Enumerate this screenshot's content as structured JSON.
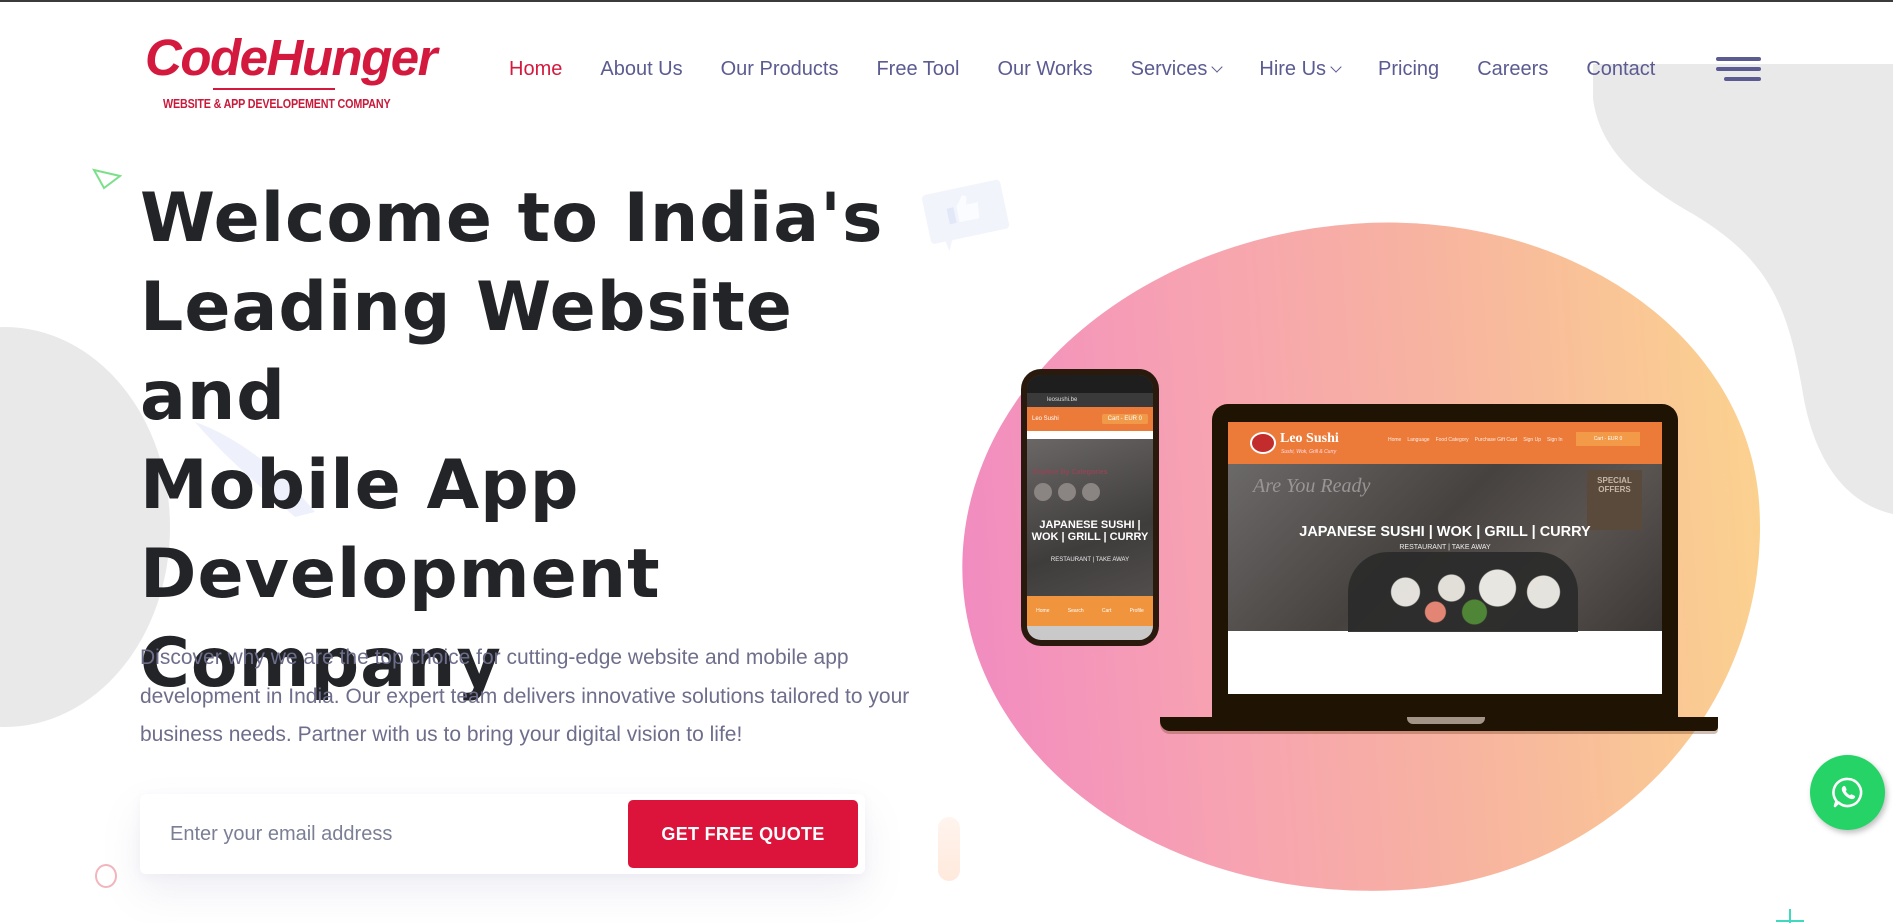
{
  "brand": {
    "name": "CodeHunger",
    "tagline": "WEBSITE & APP DEVELOPEMENT COMPANY",
    "primary_color": "#dc143c",
    "nav_color": "#5b5b92"
  },
  "nav": {
    "items": [
      {
        "label": "Home",
        "active": true,
        "dropdown": false
      },
      {
        "label": "About Us",
        "active": false,
        "dropdown": false
      },
      {
        "label": "Our Products",
        "active": false,
        "dropdown": false
      },
      {
        "label": "Free Tool",
        "active": false,
        "dropdown": false
      },
      {
        "label": "Our Works",
        "active": false,
        "dropdown": false
      },
      {
        "label": "Services",
        "active": false,
        "dropdown": true
      },
      {
        "label": "Hire Us",
        "active": false,
        "dropdown": true
      },
      {
        "label": "Pricing",
        "active": false,
        "dropdown": false
      },
      {
        "label": "Careers",
        "active": false,
        "dropdown": false
      },
      {
        "label": "Contact",
        "active": false,
        "dropdown": false
      }
    ],
    "menu_icon": "hamburger-icon"
  },
  "hero": {
    "title_lines": [
      "Welcome to India's",
      "Leading Website and",
      "Mobile App",
      "Development",
      "Company"
    ],
    "description": "Discover why we are the top choice for cutting-edge website and mobile app development in India. Our expert team delivers innovative solutions tailored to your business needs. Partner with us to bring your digital vision to life!",
    "email_placeholder": "Enter your email address",
    "email_value": "",
    "cta_label": "GET FREE QUOTE"
  },
  "showcase": {
    "laptop": {
      "brand": "Leo Sushi",
      "tagline": "Sushi, Wok, Grill & Curry",
      "menu": [
        "Home",
        "Language",
        "Food Category",
        "Purchase Gift Card",
        "Sign Up",
        "Sign In"
      ],
      "cart": "Cart - EUR 0",
      "promo_left": "Are You Ready",
      "promo_right": "SPECIAL OFFERS",
      "headline": "JAPANESE SUSHI | WOK | GRILL | CURRY",
      "subline": "RESTAURANT | TAKE AWAY"
    },
    "phone": {
      "url": "leosushi.be",
      "cart": "Cart - EUR 0",
      "section": "Explore By Categories",
      "headline": "JAPANESE SUSHI | WOK | GRILL | CURRY",
      "subline": "RESTAURANT | TAKE AWAY",
      "tabs": [
        "Home",
        "Search",
        "Cart",
        "Profile"
      ]
    }
  },
  "floating": {
    "whatsapp_icon": "whatsapp-icon",
    "whatsapp_color": "#25d366"
  }
}
